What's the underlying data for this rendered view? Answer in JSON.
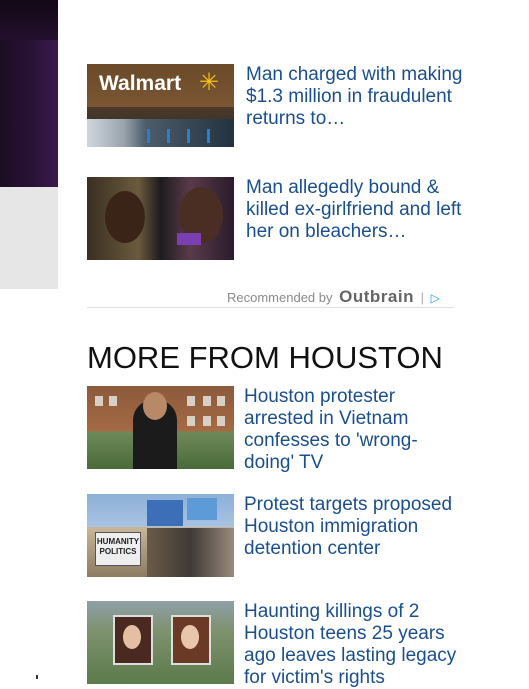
{
  "outbrain_stories": [
    {
      "headline": "Man charged with making $1.3 million in fraudulent returns to…",
      "thumb_text": "Walmart"
    },
    {
      "headline": "Man allegedly bound & killed ex-girlfriend and left her on bleachers…"
    }
  ],
  "recommended": {
    "prefix": "Recommended by",
    "brand": "Outbrain",
    "separator": "|",
    "ad_icon": "▷"
  },
  "more_section": {
    "title": "MORE FROM HOUSTON",
    "stories": [
      {
        "headline": "Houston protester arrested in Vietnam confesses to 'wrong-doing' TV"
      },
      {
        "headline": "Protest targets proposed Houston immigration detention center",
        "thumb_text": "HUMANITY POLITICS"
      },
      {
        "headline": "Haunting killings of 2 Houston teens 25 years ago leaves lasting legacy for victim's rights"
      }
    ]
  }
}
